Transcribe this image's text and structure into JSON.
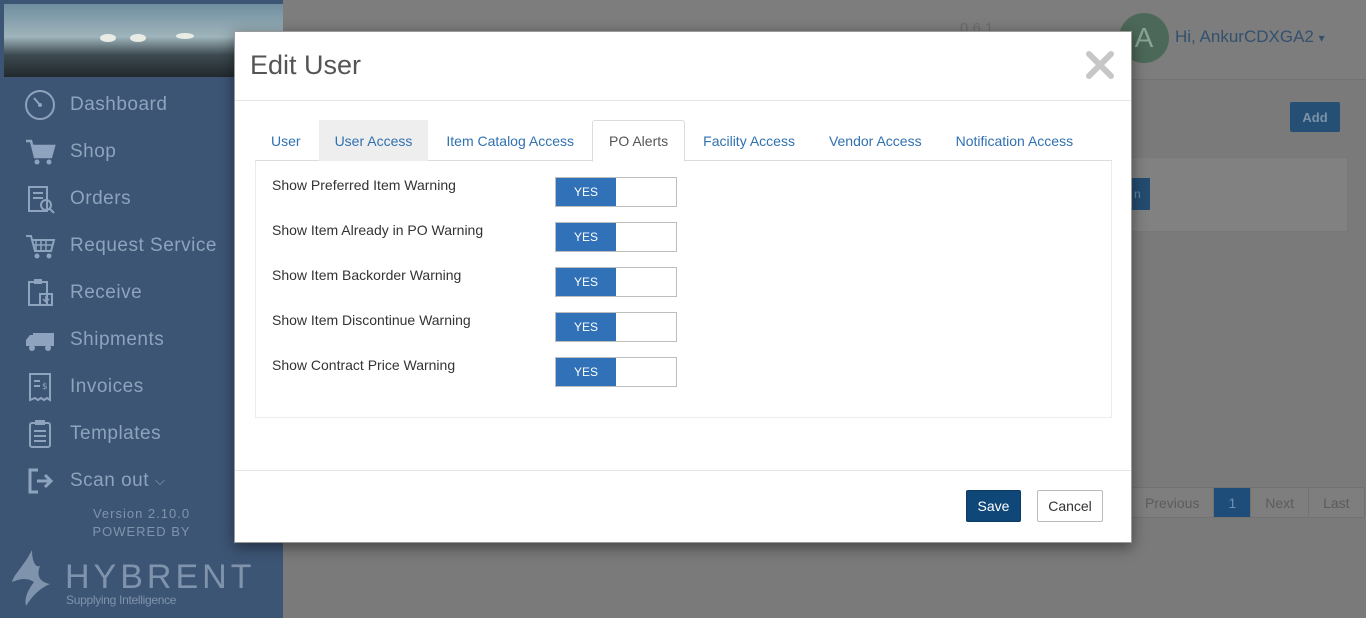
{
  "sidebar": {
    "items": [
      {
        "label": "Dashboard",
        "icon": "dashboard-icon"
      },
      {
        "label": "Shop",
        "icon": "cart-icon"
      },
      {
        "label": "Orders",
        "icon": "orders-icon"
      },
      {
        "label": "Request Service",
        "icon": "service-cart-icon"
      },
      {
        "label": "Receive",
        "icon": "receive-icon"
      },
      {
        "label": "Shipments",
        "icon": "truck-icon"
      },
      {
        "label": "Invoices",
        "icon": "invoice-icon"
      },
      {
        "label": "Templates",
        "icon": "clipboard-icon"
      },
      {
        "label": "Scan out",
        "icon": "scan-out-icon"
      }
    ],
    "version": "Version 2.10.0",
    "powered_by": "POWERED BY",
    "brand_name": "HYBRENT",
    "brand_tagline": "Supplying Intelligence"
  },
  "header": {
    "counters": "0   6   1",
    "avatar_letter": "A",
    "greeting": "Hi, AnkurCDXGA2",
    "greeting_caret": "▾"
  },
  "background": {
    "add_label": "Add",
    "panel_button_label": "n",
    "pagination": [
      "Previous",
      "1",
      "Next",
      "Last"
    ]
  },
  "modal": {
    "title": "Edit User",
    "close_label": "×",
    "tabs": [
      "User",
      "User Access",
      "Item Catalog Access",
      "PO Alerts",
      "Facility Access",
      "Vendor Access",
      "Notification Access"
    ],
    "active_tab": "PO Alerts",
    "hover_tab": "User Access",
    "alerts": [
      {
        "label": "Show Preferred Item Warning",
        "value": "YES"
      },
      {
        "label": "Show Item Already in PO Warning",
        "value": "YES"
      },
      {
        "label": "Show Item Backorder Warning",
        "value": "YES"
      },
      {
        "label": "Show Item Discontinue Warning",
        "value": "YES"
      },
      {
        "label": "Show Contract Price Warning",
        "value": "YES"
      }
    ],
    "save_label": "Save",
    "cancel_label": "Cancel"
  },
  "colors": {
    "primary": "#3071b8",
    "save": "#0e4778",
    "tab_link": "#3071b0"
  }
}
